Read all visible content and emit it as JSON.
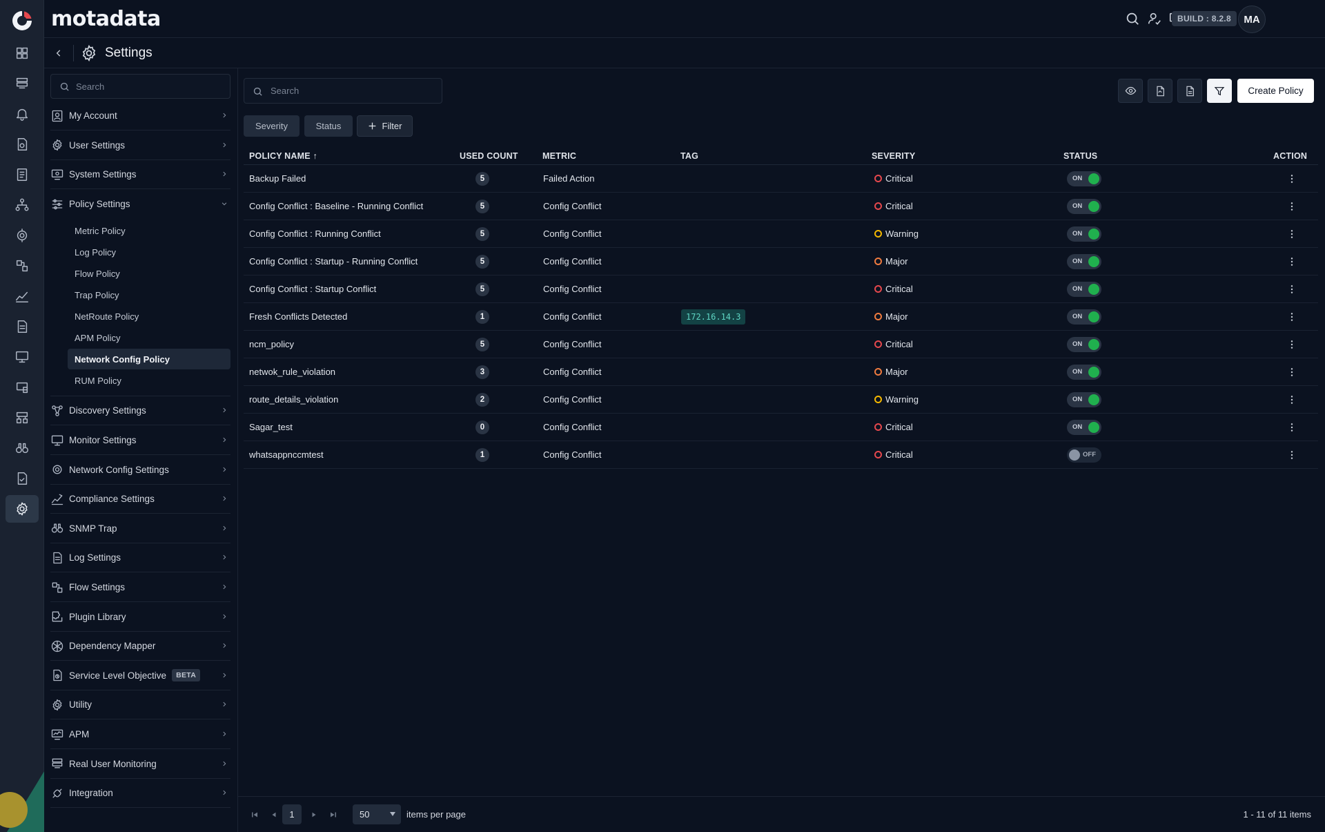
{
  "brand": {
    "name": "motadata"
  },
  "topbar": {
    "icons": [
      "search-icon",
      "user-check-icon",
      "monitor-icon",
      "bell-icon"
    ],
    "build": "BUILD : 8.2.8",
    "avatar_initials": "MA"
  },
  "rail": {
    "icons": [
      "dashboard-icon",
      "inventory-icon",
      "alert-icon",
      "policy-icon",
      "report-icon",
      "topology-icon",
      "ncm-icon",
      "flow-icon",
      "metric-icon",
      "log-icon",
      "monitor-icon",
      "device-icon",
      "network-icon",
      "binoculars-icon",
      "document-icon",
      "settings-icon"
    ],
    "active": "settings-icon"
  },
  "header": {
    "title": "Settings"
  },
  "sidebar": {
    "search_placeholder": "Search",
    "items": [
      {
        "label": "My Account",
        "icon": "user-icon"
      },
      {
        "label": "User Settings",
        "icon": "users-gear-icon"
      },
      {
        "label": "System Settings",
        "icon": "system-icon"
      },
      {
        "label": "Policy Settings",
        "icon": "sliders-icon",
        "expanded": true,
        "children": [
          "Metric Policy",
          "Log Policy",
          "Flow Policy",
          "Trap Policy",
          "NetRoute Policy",
          "APM Policy",
          "Network Config Policy",
          "RUM Policy"
        ],
        "active_child": "Network Config Policy"
      },
      {
        "label": "Discovery Settings",
        "icon": "discovery-icon"
      },
      {
        "label": "Monitor Settings",
        "icon": "monitor-icon"
      },
      {
        "label": "Network Config Settings",
        "icon": "network-config-icon"
      },
      {
        "label": "Compliance Settings",
        "icon": "compliance-icon"
      },
      {
        "label": "SNMP Trap",
        "icon": "binoculars-icon"
      },
      {
        "label": "Log Settings",
        "icon": "log-icon"
      },
      {
        "label": "Flow Settings",
        "icon": "flow-icon"
      },
      {
        "label": "Plugin Library",
        "icon": "plugin-icon"
      },
      {
        "label": "Dependency Mapper",
        "icon": "dependency-icon"
      },
      {
        "label": "Service Level Objective",
        "icon": "slo-icon",
        "badge": "BETA"
      },
      {
        "label": "Utility",
        "icon": "utility-icon"
      },
      {
        "label": "APM",
        "icon": "apm-icon"
      },
      {
        "label": "Real User Monitoring",
        "icon": "rum-icon"
      },
      {
        "label": "Integration",
        "icon": "integration-icon"
      }
    ]
  },
  "main": {
    "search_placeholder": "Search",
    "toolbar": {
      "icons": [
        "eye-icon",
        "pdf-export-icon",
        "csv-export-icon",
        "filter-icon"
      ],
      "create_label": "Create Policy"
    },
    "filters": {
      "severity": "Severity",
      "status": "Status",
      "add_filter": "Filter"
    },
    "table": {
      "columns": [
        "POLICY NAME ↑",
        "USED COUNT",
        "METRIC",
        "TAG",
        "SEVERITY",
        "STATUS",
        "ACTION"
      ],
      "rows": [
        {
          "name": "Backup Failed",
          "count": "5",
          "metric": "Failed Action",
          "tag": "",
          "severity": "Critical",
          "status": "ON"
        },
        {
          "name": "Config Conflict : Baseline - Running Conflict",
          "count": "5",
          "metric": "Config Conflict",
          "tag": "",
          "severity": "Critical",
          "status": "ON"
        },
        {
          "name": "Config Conflict : Running Conflict",
          "count": "5",
          "metric": "Config Conflict",
          "tag": "",
          "severity": "Warning",
          "status": "ON"
        },
        {
          "name": "Config Conflict : Startup - Running Conflict",
          "count": "5",
          "metric": "Config Conflict",
          "tag": "",
          "severity": "Major",
          "status": "ON"
        },
        {
          "name": "Config Conflict : Startup Conflict",
          "count": "5",
          "metric": "Config Conflict",
          "tag": "",
          "severity": "Critical",
          "status": "ON"
        },
        {
          "name": "Fresh Conflicts Detected",
          "count": "1",
          "metric": "Config Conflict",
          "tag": "172.16.14.3",
          "severity": "Major",
          "status": "ON"
        },
        {
          "name": "ncm_policy",
          "count": "5",
          "metric": "Config Conflict",
          "tag": "",
          "severity": "Critical",
          "status": "ON"
        },
        {
          "name": "netwok_rule_violation",
          "count": "3",
          "metric": "Config Conflict",
          "tag": "",
          "severity": "Major",
          "status": "ON"
        },
        {
          "name": "route_details_violation",
          "count": "2",
          "metric": "Config Conflict",
          "tag": "",
          "severity": "Warning",
          "status": "ON"
        },
        {
          "name": "Sagar_test",
          "count": "0",
          "metric": "Config Conflict",
          "tag": "",
          "severity": "Critical",
          "status": "ON"
        },
        {
          "name": "whatsappnccmtest",
          "count": "1",
          "metric": "Config Conflict",
          "tag": "",
          "severity": "Critical",
          "status": "OFF"
        }
      ]
    },
    "severity_colors": {
      "Critical": "#e5484d",
      "Major": "#f07b3f",
      "Warning": "#f5b800"
    },
    "pagination": {
      "page": "1",
      "page_size": "50",
      "items_per_page_label": "items per page",
      "summary": "1 - 11 of 11 items"
    }
  }
}
